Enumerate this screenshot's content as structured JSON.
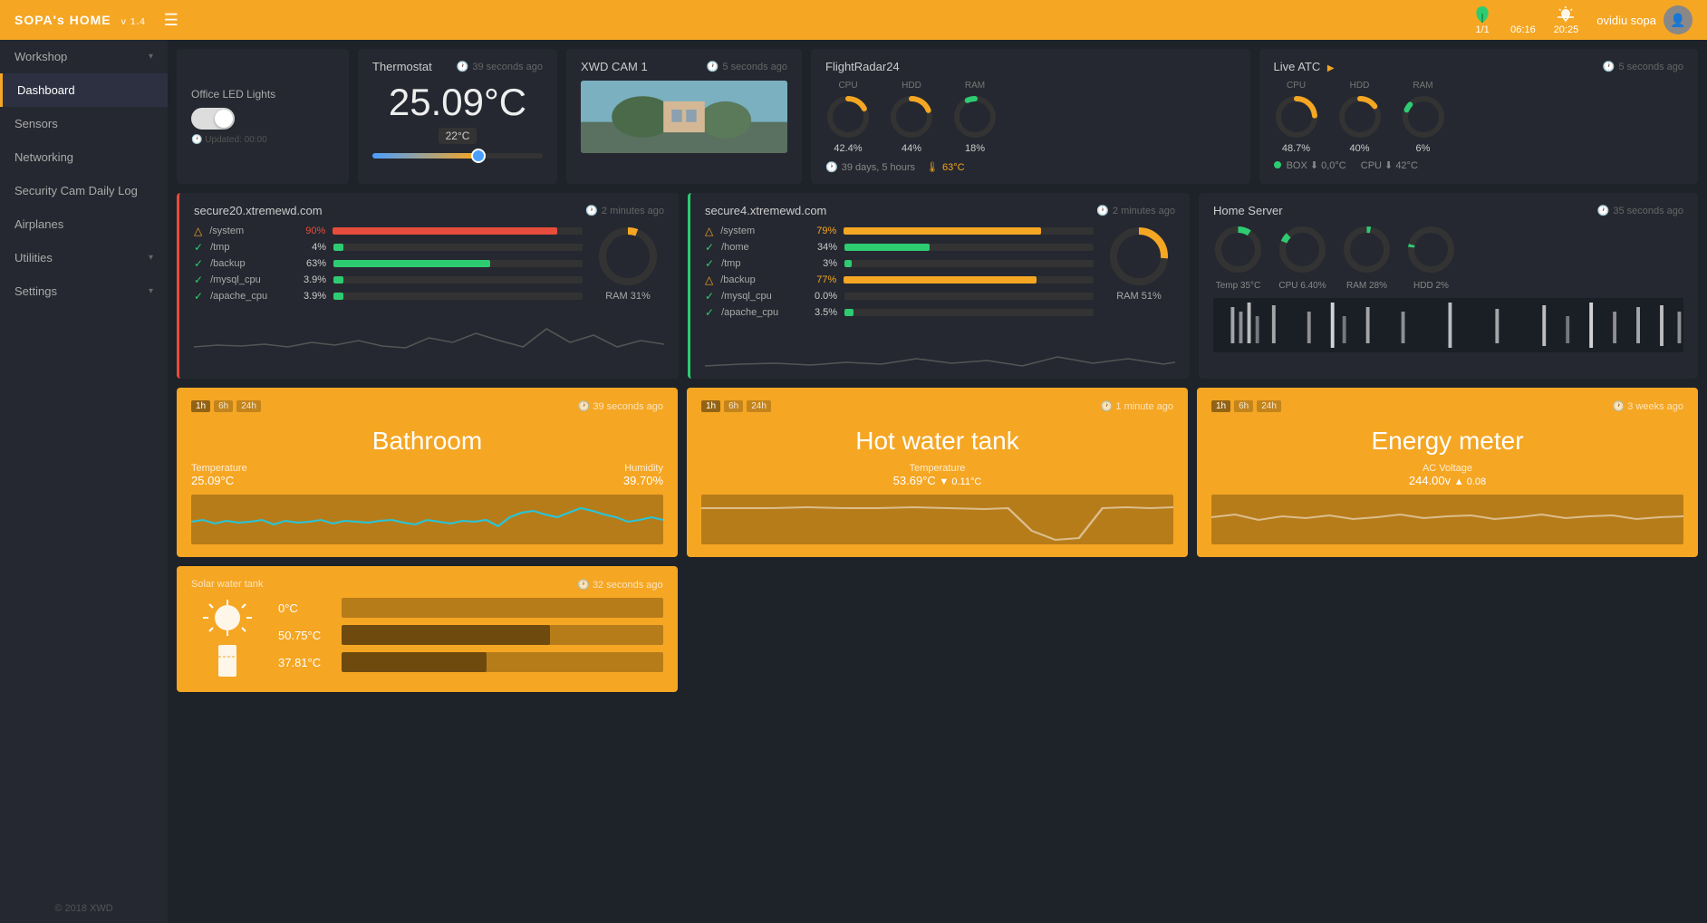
{
  "topbar": {
    "brand": "SOPA's HOME",
    "version": "v 1.4",
    "weather_icon": "☀",
    "sunrise_time": "06:16",
    "sunset_time": "20:25",
    "clock_fraction": "1/1",
    "user_name": "ovidiu sopa"
  },
  "sidebar": {
    "items": [
      {
        "label": "Workshop",
        "active": false,
        "has_children": true
      },
      {
        "label": "Dashboard",
        "active": true,
        "has_children": false
      },
      {
        "label": "Sensors",
        "active": false,
        "has_children": false
      },
      {
        "label": "Networking",
        "active": false,
        "has_children": false
      },
      {
        "label": "Security Cam Daily Log",
        "active": false,
        "has_children": false
      },
      {
        "label": "Airplanes",
        "active": false,
        "has_children": false
      },
      {
        "label": "Utilities",
        "active": false,
        "has_children": true
      },
      {
        "label": "Settings",
        "active": false,
        "has_children": true
      }
    ],
    "footer": "© 2018 XWD"
  },
  "led_card": {
    "label": "Office LED Lights",
    "updated_label": "Updated:",
    "updated_time": "00:00",
    "toggle_on": true
  },
  "thermostat": {
    "title": "Thermostat",
    "time_ago": "39 seconds ago",
    "temperature": "25.09°C",
    "setpoint": "22°C",
    "slider_pct": 60
  },
  "xwd_cam": {
    "title": "XWD CAM 1",
    "time_ago": "5 seconds ago"
  },
  "flight_radar": {
    "title": "FlightRadar24",
    "cpu_label": "CPU",
    "hdd_label": "HDD",
    "ram_label": "RAM",
    "cpu_pct": 42.4,
    "hdd_pct": 44,
    "ram_pct": 18,
    "cpu_str": "42.4%",
    "hdd_str": "44%",
    "ram_str": "18%",
    "status": "39 days, 5 hours",
    "temp": "63°C"
  },
  "live_atc": {
    "title": "Live ATC",
    "time_ago": "5 seconds ago",
    "cpu_label": "CPU",
    "hdd_label": "HDD",
    "ram_label": "RAM",
    "cpu_pct": 48.7,
    "hdd_pct": 40,
    "ram_pct": 6,
    "cpu_str": "48.7%",
    "hdd_str": "40%",
    "ram_str": "6%",
    "box_status": "BOX ⬇ 0,0°C",
    "cpu_temp": "CPU ⬇ 42°C"
  },
  "server1": {
    "title": "secure20.xtremewd.com",
    "time_ago": "2 minutes ago",
    "disks": [
      {
        "name": "/system",
        "pct": 90,
        "pct_str": "90%",
        "color": "red",
        "warn": true
      },
      {
        "name": "/tmp",
        "pct": 4,
        "pct_str": "4%",
        "color": "green",
        "warn": false
      },
      {
        "name": "/backup",
        "pct": 63,
        "pct_str": "63%",
        "color": "green",
        "warn": false
      },
      {
        "name": "/mysql_cpu",
        "pct": 3.9,
        "pct_str": "3.9%",
        "color": "green",
        "warn": false
      },
      {
        "name": "/apache_cpu",
        "pct": 3.9,
        "pct_str": "3.9%",
        "color": "green",
        "warn": false
      }
    ],
    "ram_label": "RAM 31%",
    "ram_pct": 31
  },
  "server2": {
    "title": "secure4.xtremewd.com",
    "time_ago": "2 minutes ago",
    "disks": [
      {
        "name": "/system",
        "pct": 79,
        "pct_str": "79%",
        "color": "orange",
        "warn": true
      },
      {
        "name": "/home",
        "pct": 34,
        "pct_str": "34%",
        "color": "green",
        "warn": false
      },
      {
        "name": "/tmp",
        "pct": 3,
        "pct_str": "3%",
        "color": "green",
        "warn": false
      },
      {
        "name": "/backup",
        "pct": 77,
        "pct_str": "77%",
        "color": "orange",
        "warn": true
      },
      {
        "name": "/mysql_cpu",
        "pct": 0,
        "pct_str": "0.0%",
        "color": "green",
        "warn": false
      },
      {
        "name": "/apache_cpu",
        "pct": 3.5,
        "pct_str": "3.5%",
        "color": "green",
        "warn": false
      }
    ],
    "ram_label": "RAM 51%",
    "ram_pct": 51
  },
  "home_server": {
    "title": "Home Server",
    "time_ago": "35 seconds ago",
    "temp_label": "Temp 35°C",
    "cpu_label": "CPU 6.40%",
    "ram_label": "RAM 28%",
    "hdd_label": "HDD 2%",
    "temp_pct": 35,
    "cpu_pct": 6.4,
    "ram_pct": 28,
    "hdd_pct": 2
  },
  "bathroom": {
    "title": "Bathroom",
    "time_ago": "39 seconds ago",
    "temp_label": "Temperature",
    "temp_value": "25.09°C",
    "humidity_label": "Humidity",
    "humidity_value": "39.70%",
    "tabs": [
      "1h",
      "6h",
      "24h"
    ]
  },
  "hot_water": {
    "title": "Hot water tank",
    "time_ago": "1 minute ago",
    "temp_label": "Temperature",
    "temp_value": "53.69°C",
    "temp_delta": "▼ 0.11°C",
    "tabs": [
      "1h",
      "6h",
      "24h"
    ]
  },
  "energy_meter": {
    "title": "Energy meter",
    "time_ago": "3 weeks ago",
    "voltage_label": "AC Voltage",
    "voltage_value": "244.00v",
    "voltage_delta": "▲ 0.08",
    "tabs": [
      "1h",
      "6h",
      "24h"
    ]
  },
  "solar": {
    "title": "Solar water tank",
    "time_ago": "32 seconds ago",
    "temp1": "0°C",
    "temp2": "50.75°C",
    "temp3": "37.81°C",
    "bar1_pct": 0,
    "bar2_pct": 65,
    "bar3_pct": 45
  }
}
